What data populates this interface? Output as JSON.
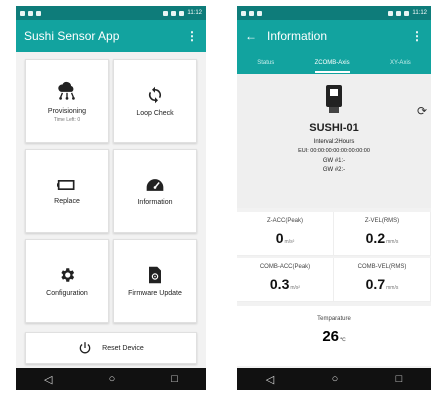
{
  "left": {
    "status_time": "11:12",
    "app_title": "Sushi Sensor App",
    "menu_icon": "kebab-menu-icon",
    "tiles": [
      {
        "label": "Provisioning",
        "sub": "Time Left: 0",
        "icon": "cloud-network-icon"
      },
      {
        "label": "Loop Check",
        "icon": "loop-arrows-icon"
      },
      {
        "label": "Replace",
        "icon": "battery-icon"
      },
      {
        "label": "Information",
        "icon": "speedometer-icon"
      },
      {
        "label": "Configuration",
        "icon": "gear-icon"
      },
      {
        "label": "Firmware Update",
        "icon": "file-gear-icon"
      }
    ],
    "reset_label": "Reset Device",
    "reset_icon": "power-icon",
    "nav": [
      "◁",
      "○",
      "□"
    ]
  },
  "right": {
    "status_time": "11:12",
    "title": "Information",
    "tabs": [
      "Status",
      "ZCOMB-Axis",
      "XY-Axis"
    ],
    "device_name": "SUSHI-01",
    "interval": "Interval:2Hours",
    "eui": "EUI: 00:00:00:00:00:00:00:00",
    "gw1": "GW #1:-",
    "gw2": "GW #2:-",
    "metrics": [
      {
        "label": "Z-ACC(Peak)",
        "value": "0",
        "unit": "m/s²"
      },
      {
        "label": "Z-VEL(RMS)",
        "value": "0.2",
        "unit": "mm/s"
      },
      {
        "label": "COMB-ACC(Peak)",
        "value": "0.3",
        "unit": "m/s²"
      },
      {
        "label": "COMB-VEL(RMS)",
        "value": "0.7",
        "unit": "mm/s"
      }
    ],
    "temperature": {
      "label": "Temparature",
      "value": "26",
      "unit": "℃"
    },
    "nav": [
      "◁",
      "○",
      "□"
    ]
  },
  "colors": {
    "status_bar": "#0e7c7a",
    "app_bar": "#12a39f",
    "nav_bar": "#111111"
  }
}
